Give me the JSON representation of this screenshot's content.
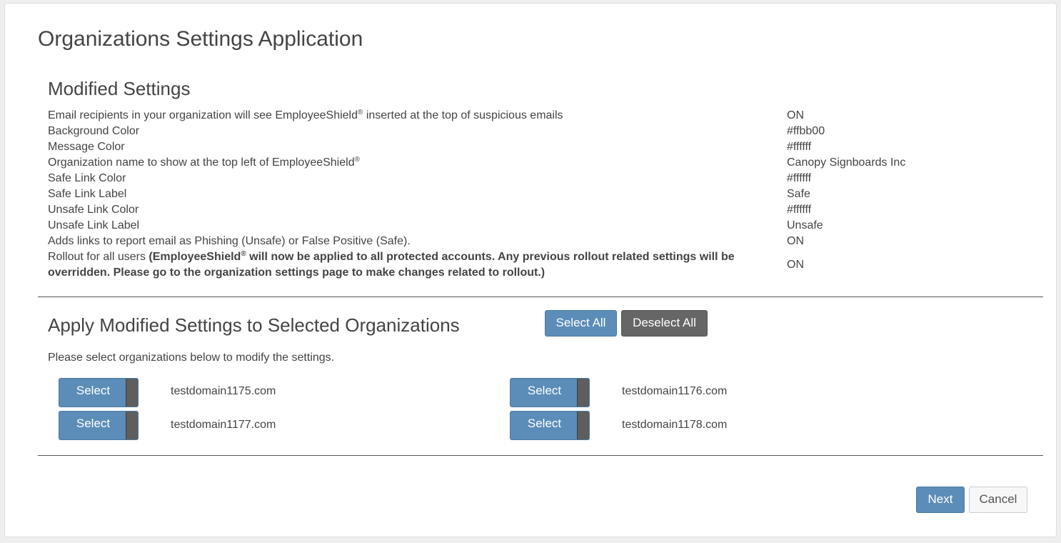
{
  "page": {
    "title": "Organizations Settings Application"
  },
  "modified_settings": {
    "heading": "Modified Settings",
    "rows": [
      {
        "label": "Email recipients in your organization will see EmployeeShield",
        "label_suffix": " inserted at the top of suspicious emails",
        "value": "ON"
      },
      {
        "label": "Background Color",
        "value": "#ffbb00"
      },
      {
        "label": "Message Color",
        "value": "#ffffff"
      },
      {
        "label": "Organization name to show at the top left of EmployeeShield",
        "label_suffix": "",
        "value": "Canopy Signboards Inc"
      },
      {
        "label": "Safe Link Color",
        "value": "#ffffff"
      },
      {
        "label": "Safe Link Label",
        "value": "Safe"
      },
      {
        "label": "Unsafe Link Color",
        "value": "#ffffff"
      },
      {
        "label": "Unsafe Link Label",
        "value": "Unsafe"
      },
      {
        "label": "Adds links to report email as Phishing (Unsafe) or False Positive (Safe).",
        "value": "ON"
      }
    ],
    "rollout": {
      "label": "Rollout for all users ",
      "bold_part1": "(EmployeeShield",
      "bold_part2": " will now be applied to all protected accounts. Any previous rollout related settings will be overridden. Please go to the organization settings page to make changes related to rollout.)",
      "value": "ON"
    },
    "registered_mark": "®"
  },
  "apply": {
    "heading": "Apply Modified Settings to Selected Organizations",
    "select_all_label": "Select All",
    "deselect_all_label": "Deselect All",
    "instruction": "Please select organizations below to modify the settings.",
    "organizations": [
      {
        "toggle_label": "Select",
        "domain": "testdomain1175.com",
        "selected": false
      },
      {
        "toggle_label": "Select",
        "domain": "testdomain1176.com",
        "selected": false
      },
      {
        "toggle_label": "Select",
        "domain": "testdomain1177.com",
        "selected": false
      },
      {
        "toggle_label": "Select",
        "domain": "testdomain1178.com",
        "selected": false
      }
    ]
  },
  "footer": {
    "next_label": "Next",
    "cancel_label": "Cancel"
  },
  "colors": {
    "primary_button": "#5b8db8",
    "secondary_button": "#666666",
    "toggle_knob": "#5e5e5e"
  }
}
